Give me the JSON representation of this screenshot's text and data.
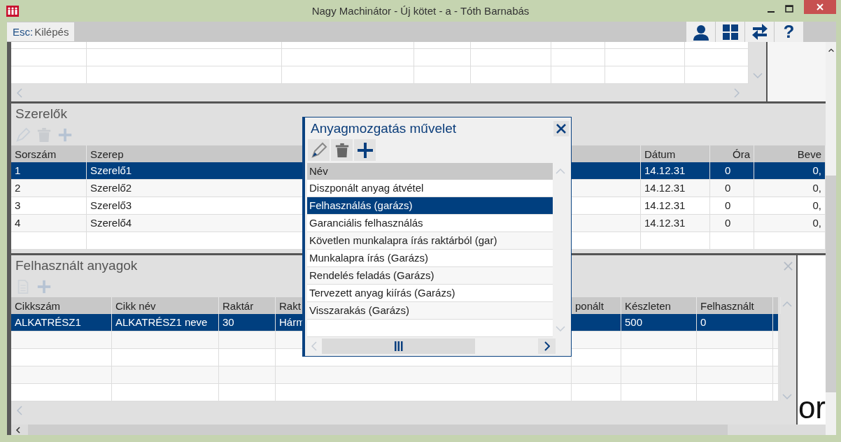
{
  "window": {
    "title": "Nagy Machinátor - Új kötet - a - Tóth Barnabás"
  },
  "toolbar": {
    "exit_key": "Esc:",
    "exit_label": "Kilépés",
    "help_label": "?"
  },
  "mechanics": {
    "title": "Szerelők",
    "tools_disabled": true,
    "columns": [
      "Sorszám",
      "Szerep",
      "Dátum",
      "Óra",
      "Beve"
    ],
    "rows": [
      {
        "cells": [
          "1",
          "Szerelő1",
          "14.12.31",
          "0",
          "0,"
        ],
        "selected": true
      },
      {
        "cells": [
          "2",
          "Szerelő2",
          "14.12.31",
          "0",
          "0,"
        ],
        "selected": false
      },
      {
        "cells": [
          "3",
          "Szerelő3",
          "14.12.31",
          "0",
          "0,"
        ],
        "selected": false
      },
      {
        "cells": [
          "4",
          "Szerelő4",
          "14.12.31",
          "0",
          "0,"
        ],
        "selected": false
      }
    ]
  },
  "materials": {
    "title": "Felhasznált anyagok",
    "tools_disabled": true,
    "columns": [
      "Cikkszám",
      "Cikk név",
      "Raktár",
      "Rakt",
      "ponált",
      "Készleten",
      "Felhasznált"
    ],
    "rows": [
      {
        "cells": [
          "ALKATRÉSZ1",
          "ALKATRÉSZ1 neve",
          "30",
          "Hárm",
          null,
          "500",
          "0"
        ],
        "selected": true
      }
    ]
  },
  "dialog": {
    "title": "Anyagmozgatás művelet",
    "column": "Név",
    "items": [
      {
        "label": "Diszponált anyag átvétel",
        "selected": false
      },
      {
        "label": "Felhasználás (garázs)",
        "selected": true
      },
      {
        "label": "Garanciális felhasználás",
        "selected": false
      },
      {
        "label": "Követlen munkalapra írás raktárból (gar)",
        "selected": false
      },
      {
        "label": "Munkalapra írás (Garázs)",
        "selected": false
      },
      {
        "label": "Rendelés feladás (Garázs)",
        "selected": false
      },
      {
        "label": "Tervezett anyag kiírás (Garázs)",
        "selected": false
      },
      {
        "label": "Visszarakás (Garázs)",
        "selected": false
      }
    ]
  },
  "background_text": "or"
}
